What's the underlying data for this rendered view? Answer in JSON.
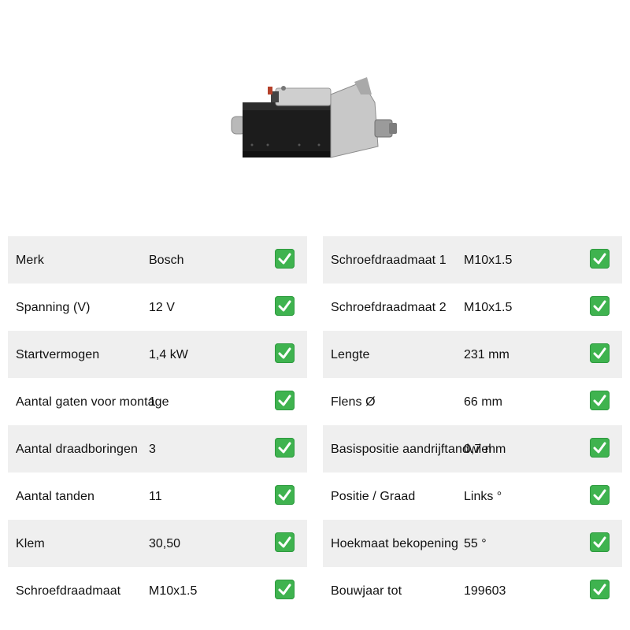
{
  "product": {
    "image_alt": "starter-motor-image"
  },
  "left_specs": [
    {
      "label": "Merk",
      "value": "Bosch"
    },
    {
      "label": "Spanning (V)",
      "value": "12 V"
    },
    {
      "label": "Startvermogen",
      "value": "1,4 kW"
    },
    {
      "label": "Aantal gaten voor montage",
      "value": "1"
    },
    {
      "label": "Aantal draadboringen",
      "value": "3"
    },
    {
      "label": "Aantal tanden",
      "value": "11"
    },
    {
      "label": "Klem",
      "value": "30,50"
    },
    {
      "label": "Schroefdraadmaat",
      "value": "M10x1.5"
    }
  ],
  "right_specs": [
    {
      "label": "Schroefdraadmaat 1",
      "value": "M10x1.5"
    },
    {
      "label": "Schroefdraadmaat 2",
      "value": "M10x1.5"
    },
    {
      "label": "Lengte",
      "value": "231 mm"
    },
    {
      "label": "Flens Ø",
      "value": "66 mm"
    },
    {
      "label": "Basispositie aandrijftandwiel",
      "value": "0,7 mm"
    },
    {
      "label": "Positie / Graad",
      "value": "Links °"
    },
    {
      "label": "Hoekmaat bekopening",
      "value": "55 °"
    },
    {
      "label": "Bouwjaar tot",
      "value": "199603"
    }
  ],
  "colors": {
    "row_alt": "#efefef",
    "check_green": "#3fb34f"
  },
  "icons": {
    "check": "check-mark-icon"
  }
}
